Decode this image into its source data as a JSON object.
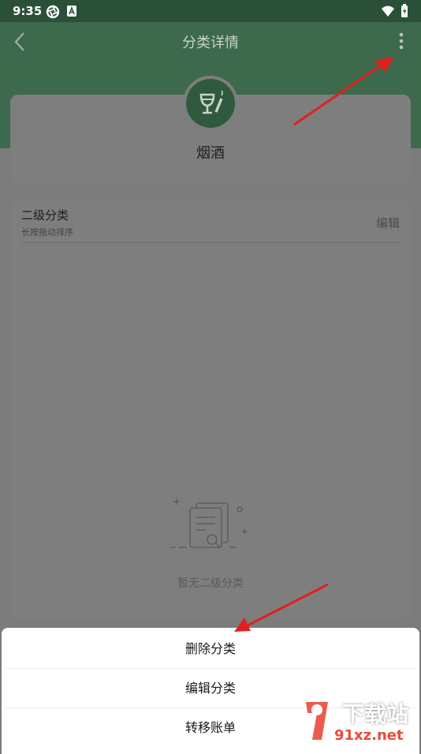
{
  "status_bar": {
    "time": "9:35"
  },
  "header": {
    "title": "分类详情"
  },
  "category": {
    "name": "烟酒"
  },
  "sub_categories": {
    "title": "二级分类",
    "hint": "长按拖动排序",
    "edit_label": "编辑",
    "empty_text": "暂无二级分类"
  },
  "bottom_sheet": {
    "items": [
      {
        "label": "删除分类"
      },
      {
        "label": "编辑分类"
      },
      {
        "label": "转移账单"
      }
    ]
  },
  "colors": {
    "brand_green": "#3d6a4d",
    "annotation_red": "#e02020"
  },
  "watermark": {
    "text": "下载站",
    "url_text": "91xz.net"
  }
}
